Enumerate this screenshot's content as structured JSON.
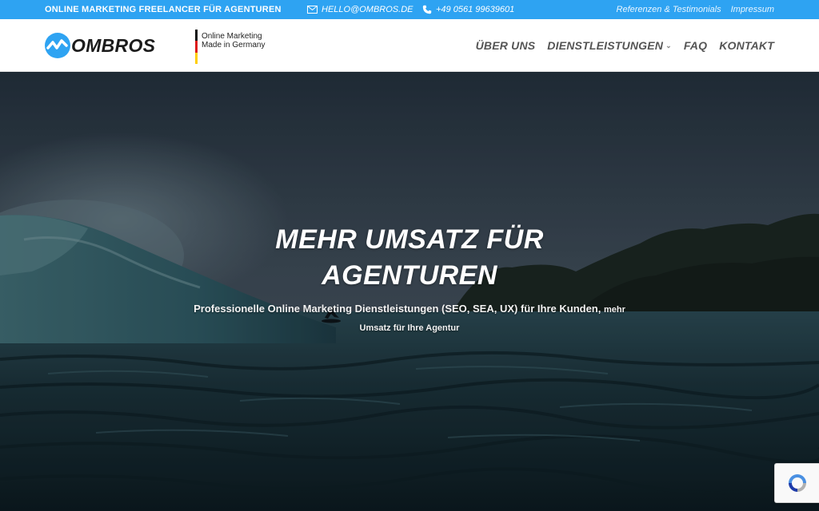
{
  "topbar": {
    "tagline": "ONLINE MARKETING FREELANCER FÜR AGENTUREN",
    "email": "HELLO@OMBROS.DE",
    "phone": "+49 0561 99639601",
    "links": [
      "Referenzen & Testimonials",
      "Impressum"
    ],
    "background": "#2ea3f2"
  },
  "header": {
    "logo_text": "OMBROS",
    "badge_line1": "Online Marketing",
    "badge_line2": "Made in Germany",
    "nav": [
      {
        "label": "ÜBER UNS"
      },
      {
        "label": "DIENSTLEISTUNGEN",
        "has_dropdown": true
      },
      {
        "label": "FAQ"
      },
      {
        "label": "KONTAKT"
      }
    ]
  },
  "hero": {
    "title_line1": "MEHR UMSATZ FÜR",
    "title_line2": "AGENTUREN",
    "subtitle_main": "Professionelle Online Marketing Dienstleistungen (SEO, SEA, UX) für Ihre Kunden,",
    "subtitle_small1": "mehr",
    "subtitle_small2": "Umsatz für Ihre Agentur"
  },
  "icons": {
    "mail": "mail-icon",
    "phone": "phone-icon",
    "recaptcha": "recaptcha-icon"
  }
}
